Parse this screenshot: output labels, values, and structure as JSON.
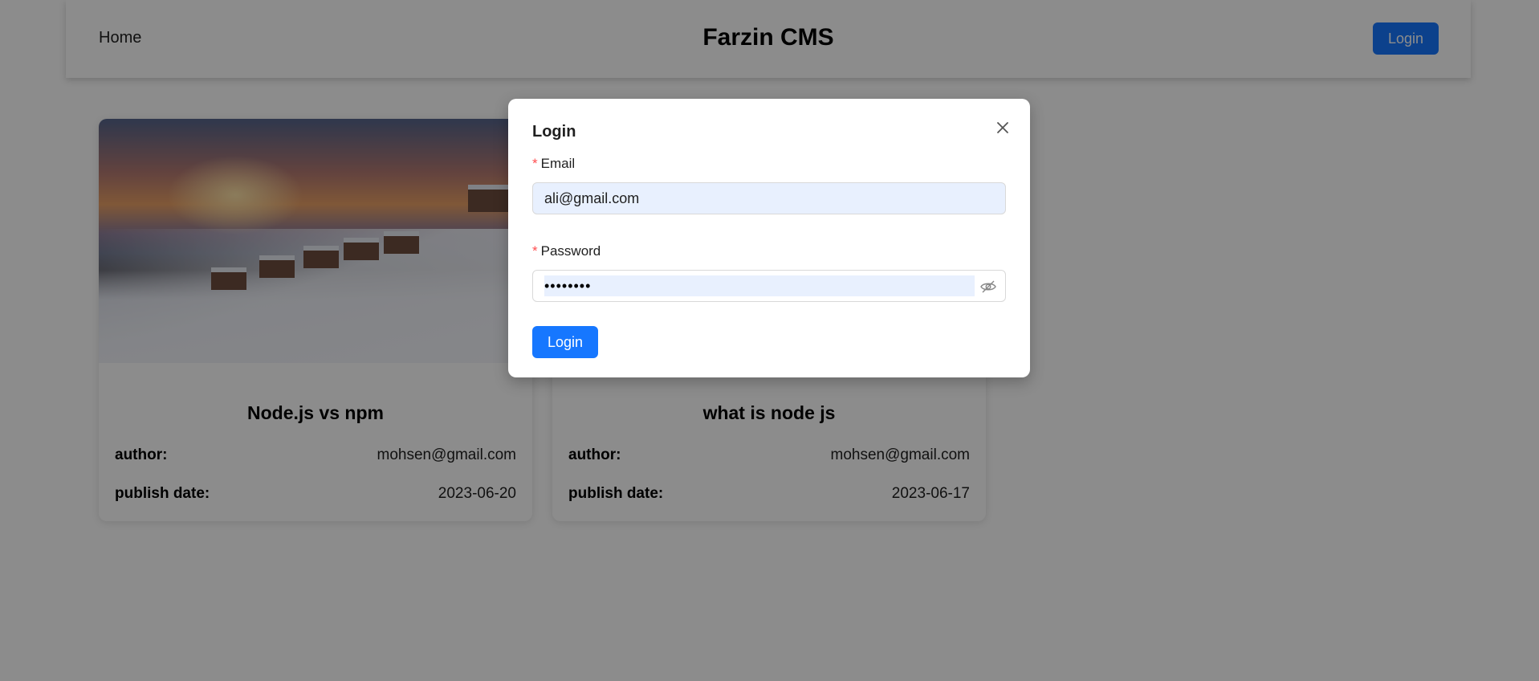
{
  "header": {
    "nav_home": "Home",
    "title": "Farzin CMS",
    "login_button": "Login"
  },
  "posts": [
    {
      "title": "Node.js vs npm",
      "author_label": "author:",
      "author": "mohsen@gmail.com",
      "date_label": "publish date:",
      "date": "2023-06-20",
      "image": "snowy-mountain-sunset"
    },
    {
      "title": "what is node js",
      "author_label": "author:",
      "author": "mohsen@gmail.com",
      "date_label": "publish date:",
      "date": "2023-06-17"
    }
  ],
  "login_modal": {
    "title": "Login",
    "close_icon": "close-icon",
    "email_label": "Email",
    "email_value": "ali@gmail.com",
    "password_label": "Password",
    "password_value": "••••••••",
    "password_icon": "eye-invisible-icon",
    "submit_label": "Login"
  },
  "colors": {
    "primary": "#1677ff",
    "required": "#ff4d4f",
    "autofill": "#e8f0fe"
  }
}
